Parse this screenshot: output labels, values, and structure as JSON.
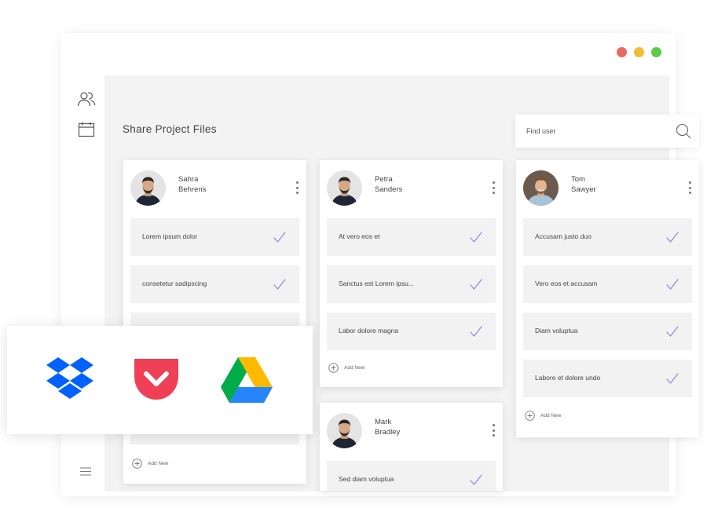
{
  "window": {
    "controls": [
      "close",
      "minimize",
      "maximize"
    ]
  },
  "sidebar": {
    "icons": [
      "users-icon",
      "calendar-icon",
      "menu-icon"
    ]
  },
  "header": {
    "title": "Share Project Files"
  },
  "search": {
    "placeholder": "Find user"
  },
  "columns": [
    {
      "first_name": "Sahra",
      "last_name": "Behrens",
      "tasks": [
        "Lorem ipsum dolor",
        "consetetur sadipscing"
      ],
      "add_label": "Add New"
    },
    {
      "first_name": "Petra",
      "last_name": "Sanders",
      "tasks": [
        "At vero eos et",
        "Sanctus est Lorem ipsu...",
        "Labor dolore magna"
      ],
      "add_label": "Add New"
    },
    {
      "first_name": "Tom",
      "last_name": "Sawyer",
      "tasks": [
        "Accusam justo duo",
        "Vero eos et accusam",
        "Diam voluptua",
        "Labore et dolore undo"
      ],
      "add_label": "Add New"
    },
    {
      "first_name": "Mark",
      "last_name": "Bradley",
      "tasks": [
        "Sed diam voluptua"
      ]
    }
  ],
  "integrations": [
    "dropbox-icon",
    "pocket-icon",
    "google-drive-icon"
  ],
  "colors": {
    "check": "#8f86d8",
    "close": "#e96a62",
    "minimize": "#f3bd32",
    "maximize": "#5dca4b",
    "dropbox": "#0061fe",
    "pocket": "#ef4056"
  }
}
